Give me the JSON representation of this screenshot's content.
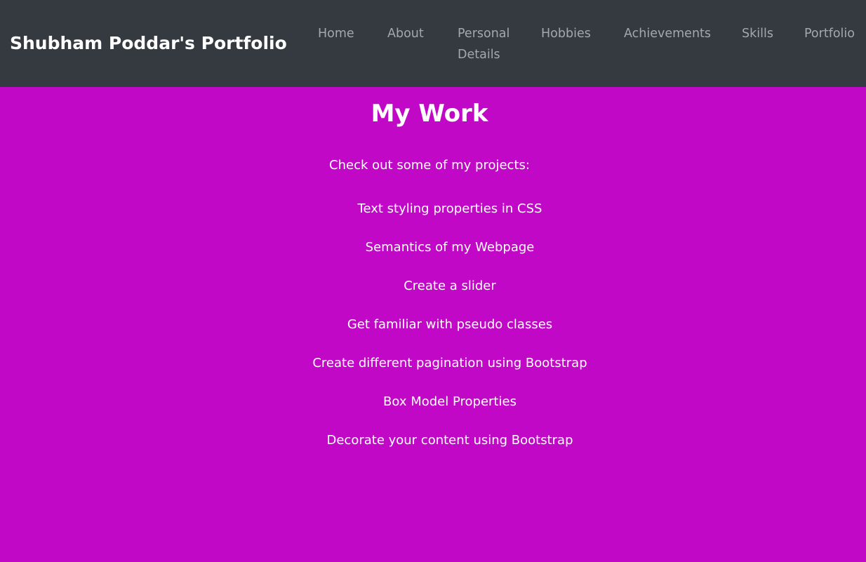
{
  "navbar": {
    "brand": "Shubham Poddar's Portfolio",
    "items": [
      {
        "label": "Home"
      },
      {
        "label": "About"
      },
      {
        "label": "Personal Details"
      },
      {
        "label": "Hobbies"
      },
      {
        "label": "Achievements"
      },
      {
        "label": "Skills"
      },
      {
        "label": "Portfolio"
      }
    ]
  },
  "main": {
    "title": "My Work",
    "intro": "Check out some of my projects:",
    "projects": [
      "Text styling properties in CSS",
      "Semantics of my Webpage",
      "Create a slider",
      "Get familiar with pseudo classes",
      "Create different pagination using Bootstrap",
      "Box Model Properties",
      "Decorate your content using Bootstrap"
    ]
  },
  "colors": {
    "navbar_bg": "#343a40",
    "page_bg": "#c108c7",
    "nav_link": "#a5a8ab",
    "text": "#ffffff"
  }
}
